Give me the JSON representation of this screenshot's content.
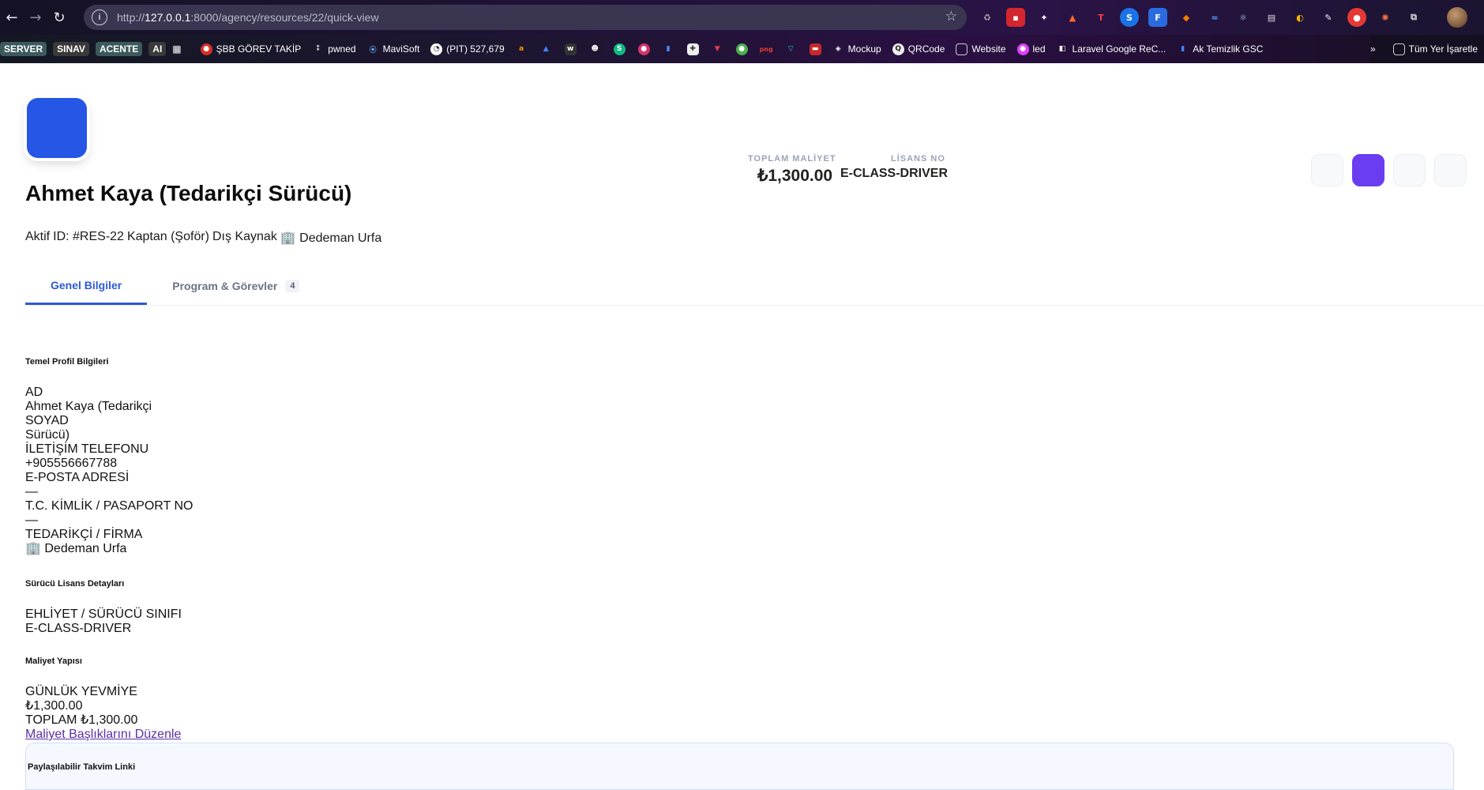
{
  "browser": {
    "url_prefix": "http://",
    "url_host": "127.0.0.1",
    "url_rest": ":8000/agency/resources/22/quick-view"
  },
  "bookmarks": {
    "tags": [
      "SERVER",
      "SINAV",
      "ACENTE",
      "AI"
    ],
    "items": [
      {
        "label": "ŞBB GÖREV TAKİP",
        "color": "#d93025"
      },
      {
        "label": "pwned",
        "color": "#444444"
      },
      {
        "label": "MaviSoft",
        "color": "#1a73e8"
      },
      {
        "label": "(PIT) 527,679",
        "color": "#333333"
      }
    ],
    "items_right": [
      {
        "label": "Mockup"
      },
      {
        "label": "QRCode"
      },
      {
        "label": "Website"
      },
      {
        "label": "led"
      },
      {
        "label": "Laravel Google ReC..."
      },
      {
        "label": "Ak Temizlik GSC"
      }
    ],
    "more": "»",
    "all_bookmarks": "Tüm Yer İşaretle"
  },
  "profile": {
    "avatar_color": "#2656e6",
    "name": "Ahmet Kaya (Tedarikçi Sürücü)",
    "sub_parts": [
      "Aktif",
      "ID: #RES-22",
      "Kaptan (Şoför)",
      "Dış Kaynak",
      "🏢 Dedeman Urfa"
    ]
  },
  "stats": {
    "total_cost_label": "TOPLAM MALİYET",
    "total_cost_value": "₺1,300.00",
    "license_label": "LİSANS NO",
    "license_value": "E-CLASS-DRIVER"
  },
  "tabs": [
    {
      "label": "Genel Bilgiler",
      "active": true
    },
    {
      "label": "Program & Görevler",
      "count": "4"
    }
  ],
  "profile_section": {
    "title": "Temel Profil Bilgileri",
    "lines": [
      "AD",
      "Ahmet Kaya (Tedarikçi",
      "SOYAD",
      "Sürücü)",
      "İLETİŞİM TELEFONU",
      "+905556667788",
      "E-POSTA ADRESİ",
      "—",
      "T.C. KİMLİK / PASAPORT NO",
      "—",
      "TEDARİKÇİ / FİRMA",
      "🏢 Dedeman Urfa"
    ]
  },
  "license_section": {
    "title": "Sürücü Lisans Detayları",
    "lines": [
      "EHLİYET / SÜRÜCÜ SINIFI",
      "E-CLASS-DRIVER"
    ]
  },
  "cost_section": {
    "title": "Maliyet Yapısı",
    "lines": [
      "GÜNLÜK YEVMİYE",
      "₺1,300.00",
      "TOPLAM ₺1,300.00"
    ],
    "edit_link": "Maliyet Başlıklarını Düzenle"
  },
  "share_section": {
    "title": "Paylaşılabilir Takvim Linki"
  },
  "colors": {
    "accent": "#2d5bd6",
    "primary_action": "#6a3df0"
  }
}
